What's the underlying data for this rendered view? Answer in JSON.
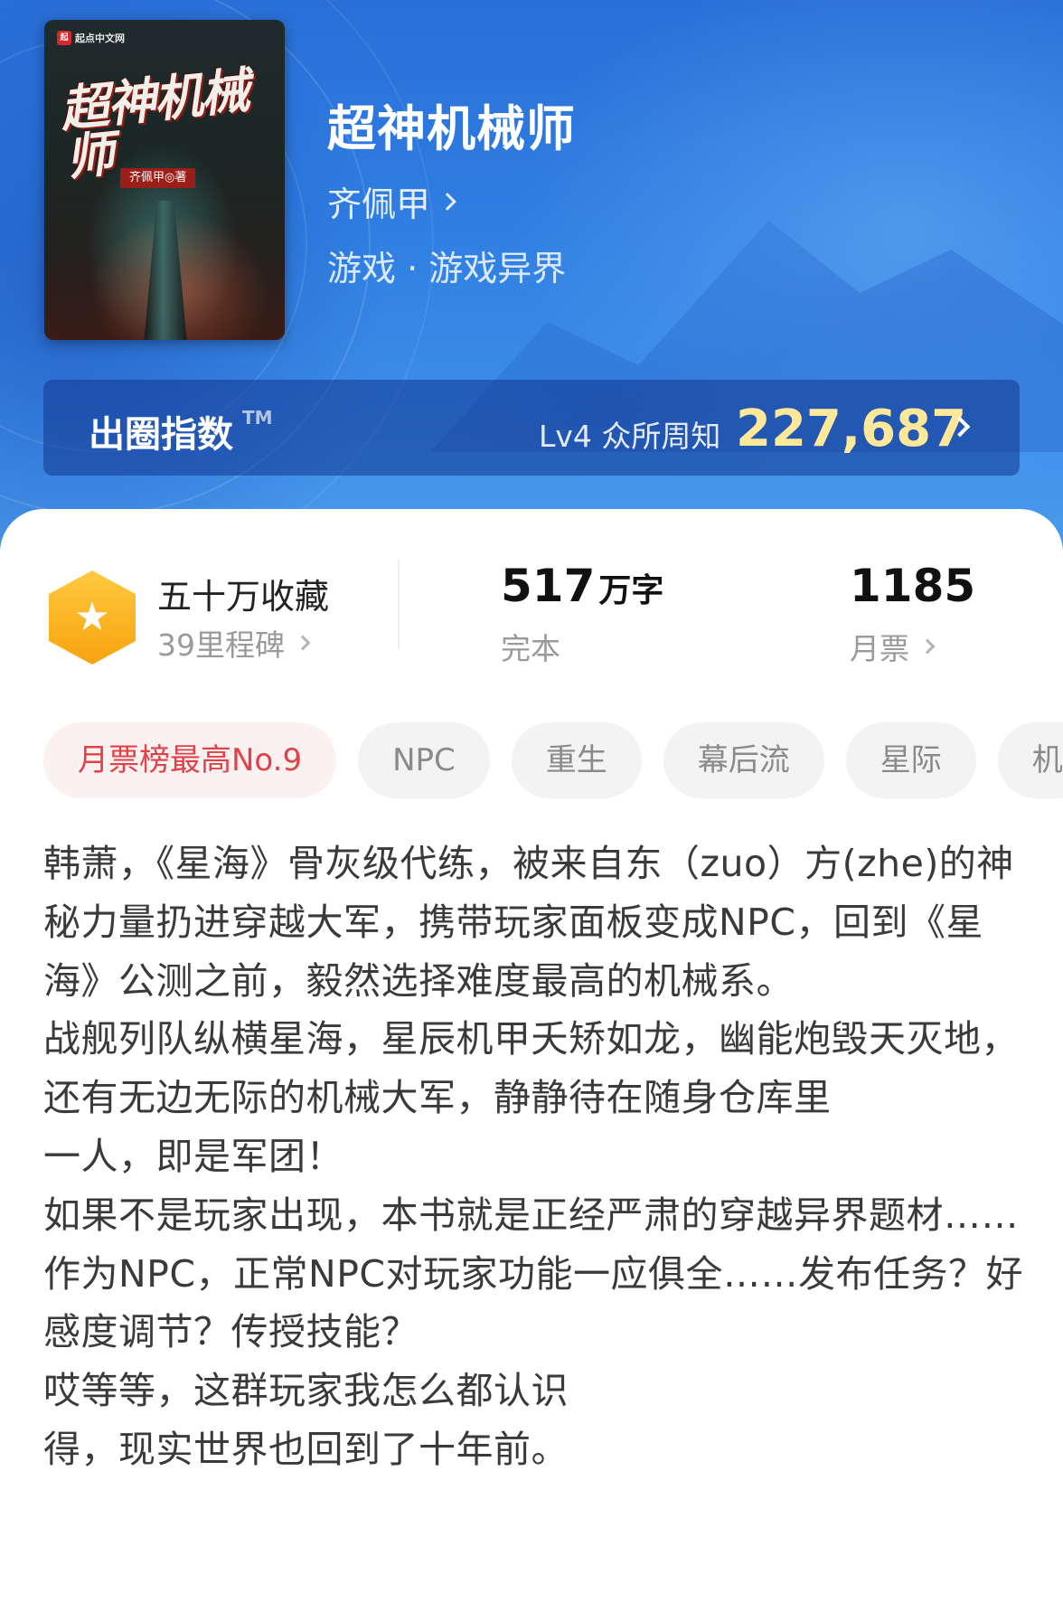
{
  "book": {
    "cover": {
      "publisher_logo": "起点中文网",
      "title": "超神机械师",
      "author_tag": "齐佩甲◎著"
    },
    "title": "超神机械师",
    "author": "齐佩甲",
    "genre": "游戏 · 游戏异界"
  },
  "index": {
    "label": "出圈指数",
    "tm": "TM",
    "level": "Lv4 众所周知",
    "value": "227,687"
  },
  "stats": {
    "collection": {
      "title": "五十万收藏",
      "sub": "39里程碑",
      "icon": "star-icon",
      "badge_color": "#f9b020"
    },
    "words": {
      "value": "517",
      "unit": "万字",
      "sub": "完本"
    },
    "votes": {
      "value": "1185",
      "sub": "月票"
    }
  },
  "tags": [
    {
      "label": "月票榜最高No.9",
      "highlight": true
    },
    {
      "label": "NPC"
    },
    {
      "label": "重生"
    },
    {
      "label": "幕后流"
    },
    {
      "label": "星际"
    },
    {
      "label": "机"
    }
  ],
  "description": [
    "韩萧，《星海》骨灰级代练，被来自东（zuo）方(zhe)的神秘力量扔进穿越大军，携带玩家面板变成NPC，回到《星海》公测之前，毅然选择难度最高的机械系。",
    "战舰列队纵横星海，星辰机甲夭矫如龙，幽能炮毁天灭地，还有无边无际的机械大军，静静待在随身仓库里",
    "一人，即是军团！",
    "如果不是玩家出现，本书就是正经严肃的穿越异界题材……",
    "作为NPC，正常NPC对玩家功能一应俱全……发布任务？好感度调节？传授技能？",
    "哎等等，这群玩家我怎么都认识",
    "得，现实世界也回到了十年前。"
  ],
  "colors": {
    "header_blue": "#2f7ee2",
    "index_value": "#ffe89a",
    "hot_tag_text": "#e0424a"
  }
}
